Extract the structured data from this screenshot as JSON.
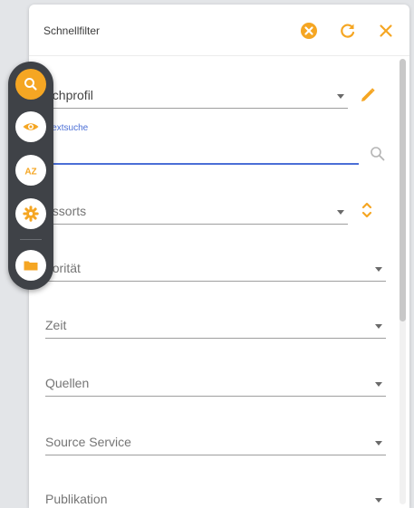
{
  "panel": {
    "title": "Schnellfilter",
    "header_icons": [
      "clear-circle-icon",
      "refresh-icon",
      "close-icon"
    ]
  },
  "fields": {
    "suchprofil": {
      "label": "uchprofil"
    },
    "volltextsuche": {
      "float_label": "lltextsuche",
      "value": ""
    },
    "ressorts": {
      "label": "essorts"
    },
    "prioritaet": {
      "label": "riorität"
    },
    "zeit": {
      "label": "Zeit"
    },
    "quellen": {
      "label": "Quellen"
    },
    "source_service": {
      "label": "Source Service"
    },
    "publikation": {
      "label": "Publikation"
    }
  },
  "toolbar": {
    "items": [
      "search-icon",
      "eye-icon",
      "sort-az-icon",
      "gear-icon",
      "folder-icon"
    ],
    "active_item": "search-icon",
    "az_text": "AZ"
  },
  "colors": {
    "accent": "#f5a623",
    "focus": "#4b6fd6",
    "toolbar_bg": "#3f4247",
    "panel_bg": "#ffffff",
    "page_bg": "#e3e5e8"
  }
}
